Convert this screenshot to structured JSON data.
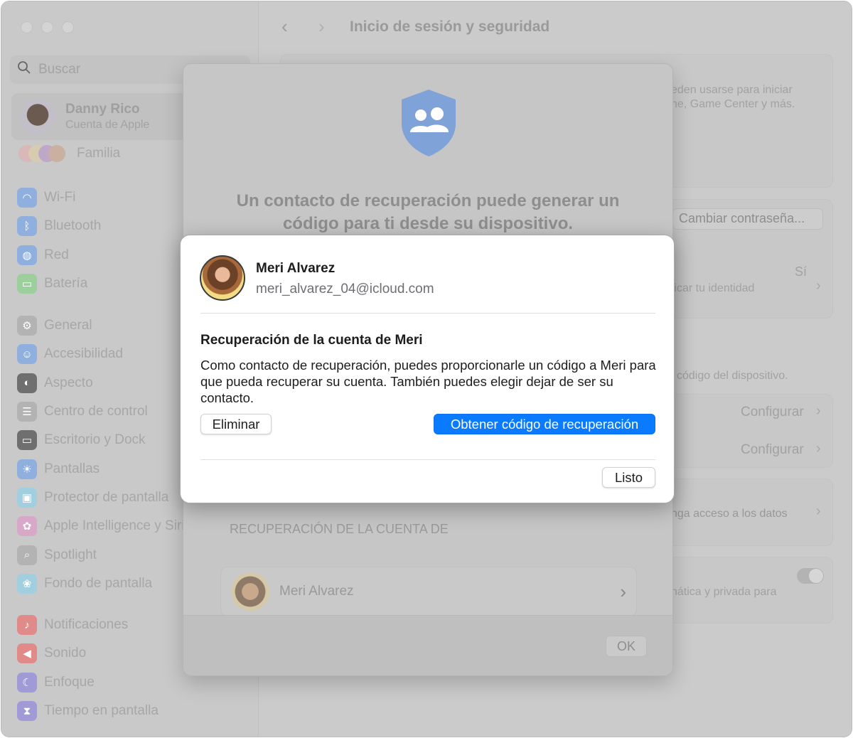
{
  "sidebar": {
    "search_placeholder": "Buscar",
    "account": {
      "name": "Danny Rico",
      "subtitle": "Cuenta de Apple"
    },
    "family": "Familia",
    "groups": [
      [
        {
          "label": "Wi-Fi",
          "icon": "wifi-icon",
          "color": "#8fb0de"
        },
        {
          "label": "Bluetooth",
          "icon": "bluetooth-icon",
          "color": "#8fb0de"
        },
        {
          "label": "Red",
          "icon": "globe-icon",
          "color": "#8fb0de"
        },
        {
          "label": "Batería",
          "icon": "battery-icon",
          "color": "#9ccf9c"
        }
      ],
      [
        {
          "label": "General",
          "icon": "gear-icon",
          "color": "#b3b3b3"
        },
        {
          "label": "Accesibilidad",
          "icon": "accessibility-icon",
          "color": "#8fb0de"
        },
        {
          "label": "Aspecto",
          "icon": "appearance-icon",
          "color": "#6f6f6f"
        },
        {
          "label": "Centro de control",
          "icon": "control-center-icon",
          "color": "#b3b3b3"
        },
        {
          "label": "Escritorio y Dock",
          "icon": "dock-icon",
          "color": "#6f6f6f"
        },
        {
          "label": "Pantallas",
          "icon": "sun-icon",
          "color": "#8fb0de"
        },
        {
          "label": "Protector de pantalla",
          "icon": "screensaver-icon",
          "color": "#a2cfe0"
        },
        {
          "label": "Apple Intelligence y Siri",
          "icon": "siri-icon",
          "color": "#d9a8c8"
        },
        {
          "label": "Spotlight",
          "icon": "search-icon",
          "color": "#b3b3b3"
        },
        {
          "label": "Fondo de pantalla",
          "icon": "flower-icon",
          "color": "#a2cfe0"
        }
      ],
      [
        {
          "label": "Notificaciones",
          "icon": "bell-icon",
          "color": "#e08a8a"
        },
        {
          "label": "Sonido",
          "icon": "speaker-icon",
          "color": "#e08a8a"
        },
        {
          "label": "Enfoque",
          "icon": "moon-icon",
          "color": "#a09ad6"
        },
        {
          "label": "Tiempo en pantalla",
          "icon": "hourglass-icon",
          "color": "#a09ad6"
        }
      ]
    ]
  },
  "main": {
    "title": "Inicio de sesión y seguridad",
    "bg": {
      "line1": "eden usarse para iniciar",
      "line2": "ne, Game Center y más.",
      "change_password": "Cambiar contraseña...",
      "yes": "Sí",
      "verify": "ficar tu identidad",
      "device_code": "l código del dispositivo.",
      "configure1": "Configurar",
      "configure2": "Configurar",
      "access": "nga acceso a los datos",
      "private": "nática y privada para"
    }
  },
  "sheet": {
    "heading_line1": "Un contacto de recuperación puede generar un",
    "heading_line2": "código para ti desde su dispositivo.",
    "section": "RECUPERACIÓN DE LA CUENTA DE",
    "contact": "Meri Alvarez",
    "ok": "OK"
  },
  "dialog": {
    "name": "Meri Alvarez",
    "email": "meri_alvarez_04@icloud.com",
    "heading": "Recuperación de la cuenta de Meri",
    "body": "Como contacto de recuperación, puedes proporcionarle un código a Meri para que pueda recuperar su cuenta. También puedes elegir dejar de ser su contacto.",
    "remove": "Eliminar",
    "get_code": "Obtener código de recuperación",
    "done": "Listo",
    "accent": "#0a7aff"
  }
}
